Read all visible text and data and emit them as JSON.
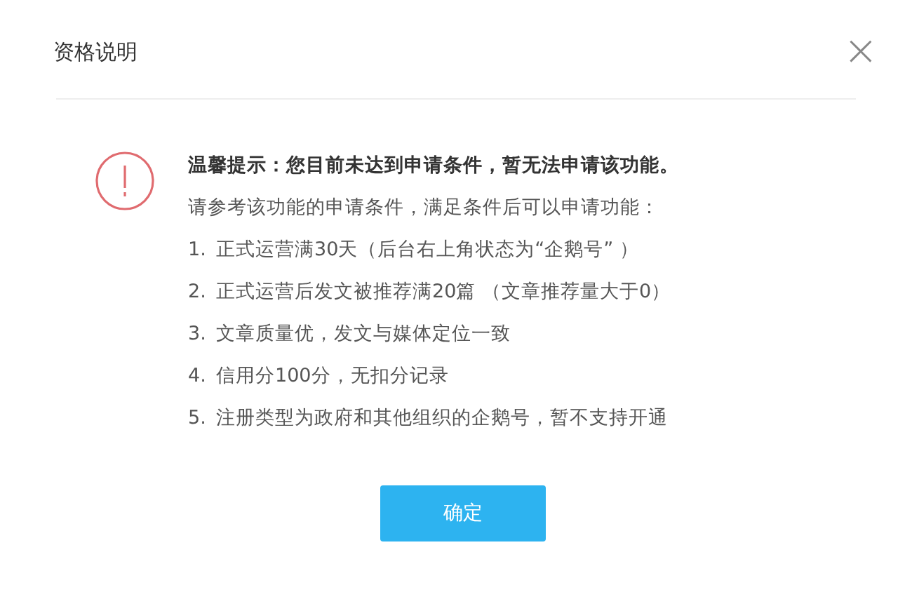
{
  "dialog": {
    "title": "资格说明",
    "close": "×"
  },
  "notice": {
    "heading": "温馨提示：您目前未达到申请条件，暂无法申请该功能。",
    "intro": "请参考该功能的申请条件，满足条件后可以申请功能：",
    "conditions": [
      {
        "number": "1.",
        "text": "正式运营满30天（后台右上角状态为“企鹅号”  ）"
      },
      {
        "number": "2.",
        "text": "正式运营后发文被推荐满20篇 （文章推荐量大于0）"
      },
      {
        "number": "3.",
        "text": "文章质量优，发文与媒体定位一致"
      },
      {
        "number": "4.",
        "text": "信用分100分，无扣分记录"
      },
      {
        "number": "5.",
        "text": "注册类型为政府和其他组织的企鹅号，暂不支持开通"
      }
    ]
  },
  "buttons": [
    {
      "label": "确定"
    }
  ]
}
